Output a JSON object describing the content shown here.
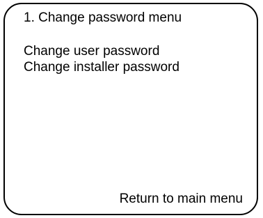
{
  "screen": {
    "title": "1. Change password menu",
    "menu_items": [
      {
        "label": "Change user password"
      },
      {
        "label": "Change installer password"
      }
    ],
    "return_label": "Return to main menu"
  }
}
